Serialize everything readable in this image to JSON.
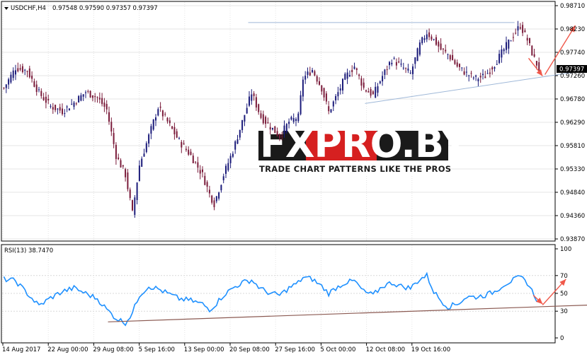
{
  "header": {
    "symbol_label": "USDCHF,H4",
    "ohlc": "0.97548 0.97590 0.97357 0.97397",
    "triangle_icon": "triangle-down-icon"
  },
  "rsi_header": "RSI(13) 38.7470",
  "watermark": {
    "logo_text": "FXPRO.BY",
    "tagline": "TRADE CHART PATTERNS LIKE THE PROS"
  },
  "colors": {
    "bull": "#1b1b7a",
    "bear": "#7a1b3a",
    "rsi_line": "#1e90ff",
    "trendline": "#9fb8d8",
    "rsi_trend": "#8b5a52",
    "arrow": "#f0584a",
    "price_tag": "#000000",
    "grid": "#e4e4e4"
  },
  "chart_data": [
    {
      "type": "candlestick",
      "instrument": "USDCHF",
      "timeframe": "H4",
      "last_price_label": "0.97397",
      "y_ticks": [
        "0.98710",
        "0.98230",
        "0.97740",
        "0.97260",
        "0.96780",
        "0.96290",
        "0.95810",
        "0.95330",
        "0.94840",
        "0.94360",
        "0.93870"
      ],
      "ylim": [
        0.9387,
        0.9871
      ],
      "x_ticks": [
        "14 Aug 2017",
        "22 Aug 00:00",
        "29 Aug 08:00",
        "5 Sep 16:00",
        "13 Sep 00:00",
        "20 Sep 08:00",
        "27 Sep 16:00",
        "5 Oct 00:00",
        "12 Oct 08:00",
        "19 Oct 16:00"
      ],
      "close_path": [
        [
          0,
          0.97
        ],
        [
          5,
          0.9742
        ],
        [
          10,
          0.9736
        ],
        [
          15,
          0.969
        ],
        [
          20,
          0.9662
        ],
        [
          25,
          0.9652
        ],
        [
          30,
          0.967
        ],
        [
          35,
          0.9692
        ],
        [
          40,
          0.968
        ],
        [
          44,
          0.9655
        ],
        [
          48,
          0.956
        ],
        [
          52,
          0.952
        ],
        [
          55,
          0.944
        ],
        [
          58,
          0.954
        ],
        [
          62,
          0.96
        ],
        [
          66,
          0.966
        ],
        [
          70,
          0.963
        ],
        [
          75,
          0.959
        ],
        [
          80,
          0.956
        ],
        [
          85,
          0.952
        ],
        [
          88,
          0.948
        ],
        [
          90,
          0.946
        ],
        [
          94,
          0.952
        ],
        [
          98,
          0.957
        ],
        [
          102,
          0.963
        ],
        [
          106,
          0.969
        ],
        [
          110,
          0.964
        ],
        [
          114,
          0.962
        ],
        [
          118,
          0.96
        ],
        [
          122,
          0.963
        ],
        [
          126,
          0.964
        ],
        [
          128,
          0.972
        ],
        [
          132,
          0.9738
        ],
        [
          136,
          0.97
        ],
        [
          139,
          0.965
        ],
        [
          142,
          0.968
        ],
        [
          146,
          0.9722
        ],
        [
          150,
          0.9745
        ],
        [
          154,
          0.97
        ],
        [
          158,
          0.9685
        ],
        [
          162,
          0.9725
        ],
        [
          166,
          0.976
        ],
        [
          170,
          0.9745
        ],
        [
          174,
          0.973
        ],
        [
          178,
          0.979
        ],
        [
          181,
          0.9815
        ],
        [
          184,
          0.98
        ],
        [
          187,
          0.978
        ],
        [
          190,
          0.977
        ],
        [
          194,
          0.9745
        ],
        [
          198,
          0.973
        ],
        [
          202,
          0.972
        ],
        [
          206,
          0.9725
        ],
        [
          210,
          0.975
        ],
        [
          214,
          0.978
        ],
        [
          218,
          0.981
        ],
        [
          221,
          0.983
        ],
        [
          224,
          0.98
        ],
        [
          227,
          0.976
        ],
        [
          229,
          0.974
        ]
      ],
      "resistance_level": 0.9836,
      "support_trendline": [
        [
          155,
          0.9668
        ],
        [
          279,
          0.9758
        ]
      ],
      "forecast_arrows": [
        [
          [
            225,
            0.9762
          ],
          [
            231,
            0.9725
          ]
        ],
        [
          [
            232,
            0.9728
          ],
          [
            245,
            0.983
          ]
        ]
      ]
    },
    {
      "type": "line",
      "name": "RSI(13)",
      "last_value": 38.747,
      "y_ticks": [
        "100",
        "70",
        "50",
        "30",
        "0"
      ],
      "ylim": [
        0,
        100
      ],
      "values_path": [
        [
          0,
          66
        ],
        [
          5,
          64
        ],
        [
          10,
          50
        ],
        [
          15,
          36
        ],
        [
          20,
          45
        ],
        [
          25,
          52
        ],
        [
          30,
          56
        ],
        [
          35,
          50
        ],
        [
          40,
          44
        ],
        [
          44,
          32
        ],
        [
          48,
          22
        ],
        [
          52,
          17
        ],
        [
          55,
          28
        ],
        [
          58,
          48
        ],
        [
          62,
          58
        ],
        [
          66,
          55
        ],
        [
          70,
          50
        ],
        [
          75,
          44
        ],
        [
          80,
          42
        ],
        [
          85,
          38
        ],
        [
          88,
          32
        ],
        [
          90,
          36
        ],
        [
          94,
          48
        ],
        [
          98,
          56
        ],
        [
          102,
          62
        ],
        [
          106,
          65
        ],
        [
          110,
          55
        ],
        [
          114,
          50
        ],
        [
          118,
          48
        ],
        [
          122,
          56
        ],
        [
          126,
          62
        ],
        [
          128,
          68
        ],
        [
          132,
          66
        ],
        [
          136,
          58
        ],
        [
          139,
          50
        ],
        [
          142,
          56
        ],
        [
          146,
          62
        ],
        [
          150,
          64
        ],
        [
          154,
          52
        ],
        [
          158,
          48
        ],
        [
          162,
          58
        ],
        [
          166,
          62
        ],
        [
          170,
          58
        ],
        [
          174,
          56
        ],
        [
          178,
          66
        ],
        [
          181,
          70
        ],
        [
          184,
          52
        ],
        [
          187,
          42
        ],
        [
          190,
          35
        ],
        [
          194,
          38
        ],
        [
          198,
          46
        ],
        [
          202,
          46
        ],
        [
          206,
          48
        ],
        [
          210,
          52
        ],
        [
          214,
          60
        ],
        [
          218,
          65
        ],
        [
          221,
          68
        ],
        [
          224,
          62
        ],
        [
          227,
          48
        ],
        [
          229,
          39
        ]
      ],
      "trendline": [
        [
          45,
          18
        ],
        [
          252,
          37
        ]
      ],
      "forecast_arrow": [
        [
          231,
          37
        ],
        [
          241,
          66
        ]
      ]
    }
  ]
}
